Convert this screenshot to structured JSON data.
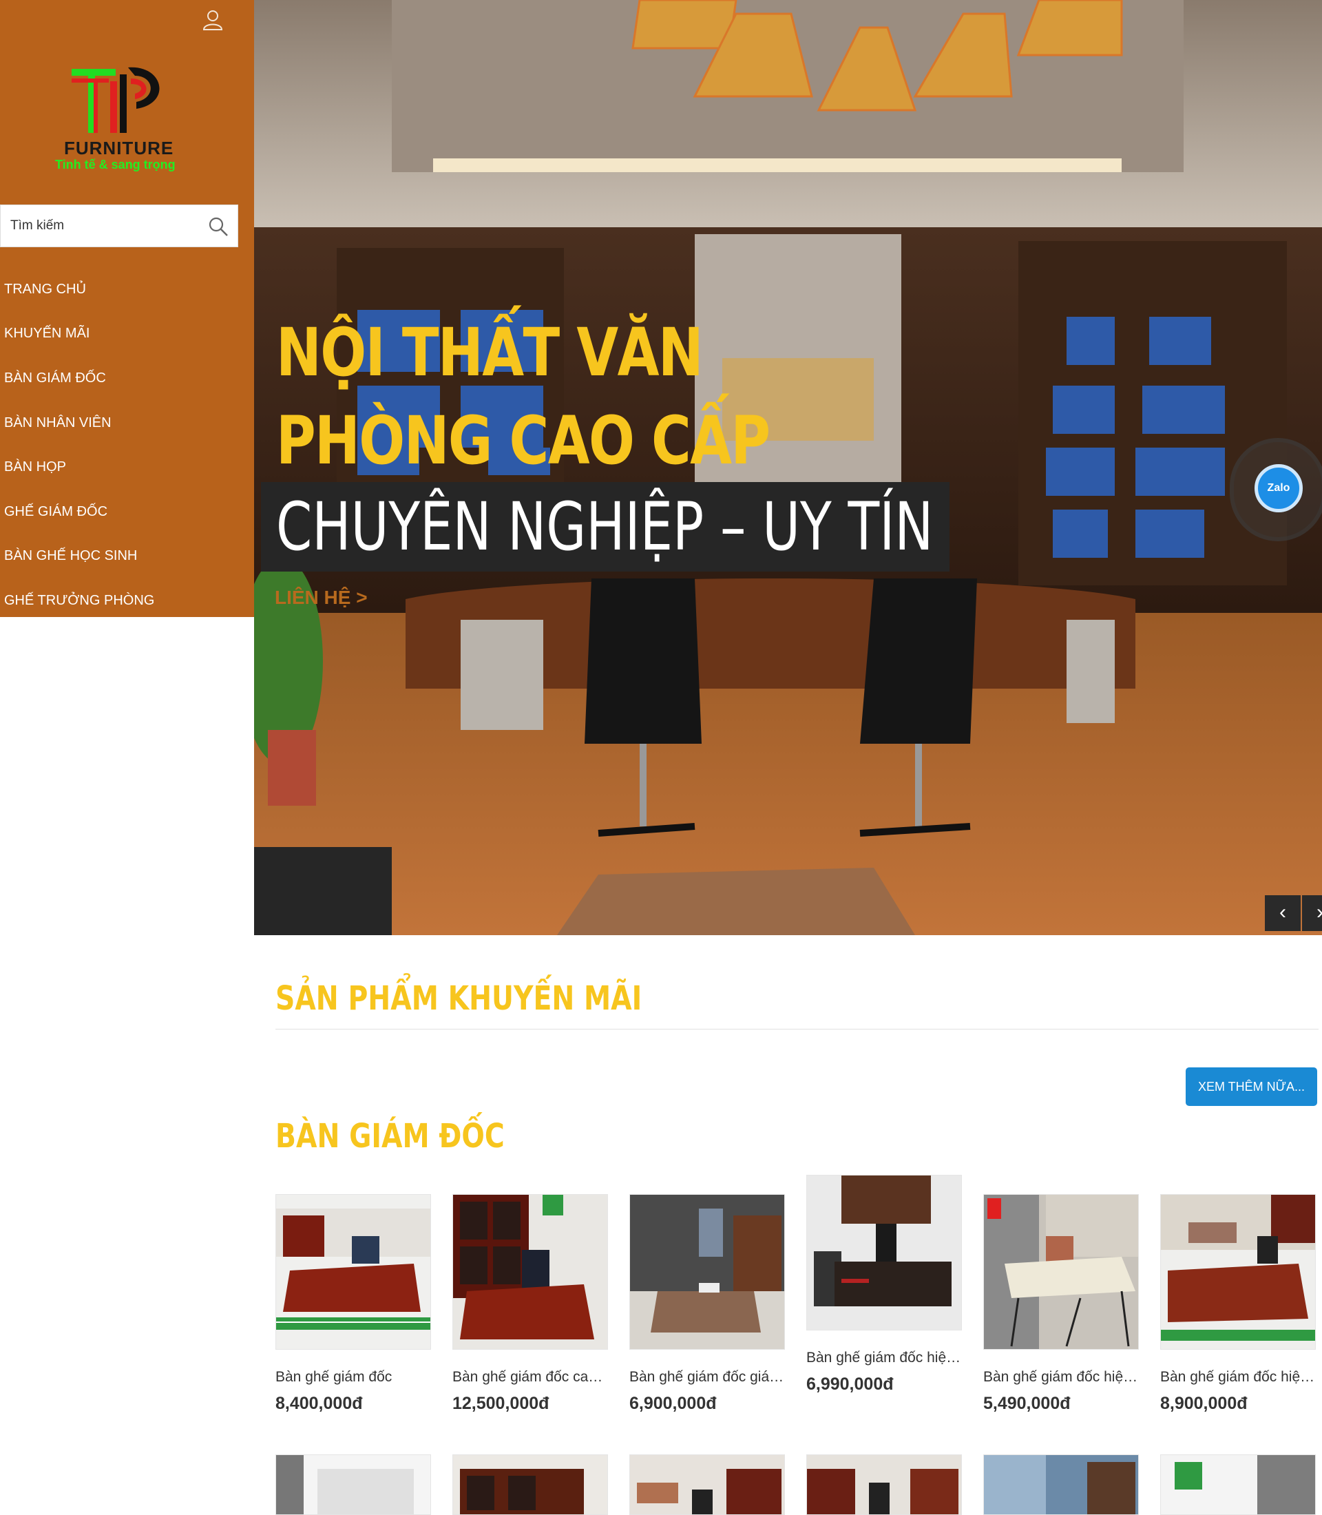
{
  "sidebar": {
    "logo_word": "FURNITURE",
    "logo_tagline": "Tinh tế & sang trọng",
    "search_placeholder": "Tìm kiếm",
    "menu": [
      "TRANG CHỦ",
      "KHUYẾN MÃI",
      "BÀN GIÁM ĐỐC",
      "BÀN NHÂN VIÊN",
      "BÀN HỌP",
      "GHẾ GIÁM ĐỐC",
      "BÀN GHẾ HỌC SINH",
      "GHẾ TRƯỞNG PHÒNG"
    ]
  },
  "hero": {
    "title": "NỘI THẤT VĂN PHÒNG CAO CẤP",
    "subtitle": "CHUYÊN NGHIỆP – UY TÍN",
    "contact": "LIÊN HỆ  >",
    "prev_icon": "‹",
    "next_icon": "›"
  },
  "zalo": {
    "label": "Zalo"
  },
  "sections": {
    "promo_title": "SẢN PHẨM KHUYẾN MÃI",
    "more_button": "XEM THÊM NỮA...",
    "director_title": "BÀN GIÁM ĐỐC"
  },
  "products": [
    {
      "name": "Bàn ghế giám đốc",
      "price": "8,400,000đ"
    },
    {
      "name": "Bàn ghế giám đốc cao c...",
      "price": "12,500,000đ"
    },
    {
      "name": "Bàn ghế giám đốc giá rẻ",
      "price": "6,900,000đ"
    },
    {
      "name": "Bàn ghế giám đốc hiện ...",
      "price": "6,990,000đ"
    },
    {
      "name": "Bàn ghế giám đốc hiện ...",
      "price": "5,490,000đ"
    },
    {
      "name": "Bàn ghế giám đốc hiện ...",
      "price": "8,900,000đ"
    }
  ],
  "colors": {
    "sidebar": "#b8621b",
    "accent_yellow": "#f7c51e",
    "button_blue": "#1a8ad4",
    "logo_green": "#22ee22",
    "logo_red": "#e02020"
  }
}
